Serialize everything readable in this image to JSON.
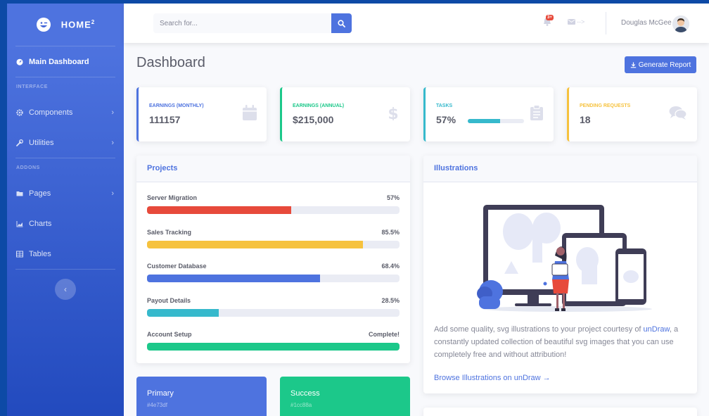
{
  "brand": {
    "name": "HOME",
    "sup": "2",
    "icon": "laugh-wink-icon"
  },
  "sidebar": {
    "main_item": {
      "label": "Main Dashboard",
      "icon": "tachometer-icon"
    },
    "heading_interface": "INTERFACE",
    "heading_addons": "ADDONS",
    "items": [
      {
        "label": "Components",
        "icon": "cog-icon",
        "has_chevron": true
      },
      {
        "label": "Utilities",
        "icon": "wrench-icon",
        "has_chevron": true
      },
      {
        "label": "Pages",
        "icon": "folder-icon",
        "has_chevron": true
      },
      {
        "label": "Charts",
        "icon": "chart-area-icon",
        "has_chevron": false
      },
      {
        "label": "Tables",
        "icon": "table-icon",
        "has_chevron": false
      }
    ],
    "chevron": "›",
    "toggle": "‹"
  },
  "topbar": {
    "search_placeholder": "Search for...",
    "alerts_badge": "3+",
    "messages_text": "-->",
    "user_name": "Douglas McGee"
  },
  "page": {
    "title": "Dashboard",
    "generate_report": "Generate Report"
  },
  "stats": [
    {
      "label": "EARNINGS (MONTHLY)",
      "value": "111157",
      "color": "#4e73df",
      "icon": "calendar-icon"
    },
    {
      "label": "EARNINGS (ANNUAL)",
      "value": "$215,000",
      "color": "#1cc88a",
      "icon": "dollar-icon"
    },
    {
      "label": "TASKS",
      "value": "57%",
      "color": "#36b9cc",
      "icon": "clipboard-icon",
      "progress": 0.57
    },
    {
      "label": "PENDING REQUESTS",
      "value": "18",
      "color": "#f6c23e",
      "icon": "comments-icon"
    }
  ],
  "projects": {
    "title": "Projects",
    "items": [
      {
        "name": "Server Migration",
        "value": "57%",
        "progress": 0.57,
        "color": "#e74a3b"
      },
      {
        "name": "Sales Tracking",
        "value": "85.5%",
        "progress": 0.855,
        "color": "#f6c23e"
      },
      {
        "name": "Customer Database",
        "value": "68.4%",
        "progress": 0.684,
        "color": "#4e73df"
      },
      {
        "name": "Payout Details",
        "value": "28.5%",
        "progress": 0.285,
        "color": "#36b9cc"
      },
      {
        "name": "Account Setup",
        "value": "Complete!",
        "progress": 1.0,
        "color": "#1cc88a"
      }
    ]
  },
  "illustrations": {
    "title": "Illustrations",
    "text_before": "Add some quality, svg illustrations to your project courtesy of ",
    "link_text": "unDraw",
    "text_after": ", a constantly updated collection of beautiful svg images that you can use completely free and without attribution!",
    "browse_link": "Browse Illustrations on unDraw →"
  },
  "color_cards": [
    {
      "name": "Primary",
      "hex": "#4e73df"
    },
    {
      "name": "Success",
      "hex": "#1cc88a"
    }
  ]
}
